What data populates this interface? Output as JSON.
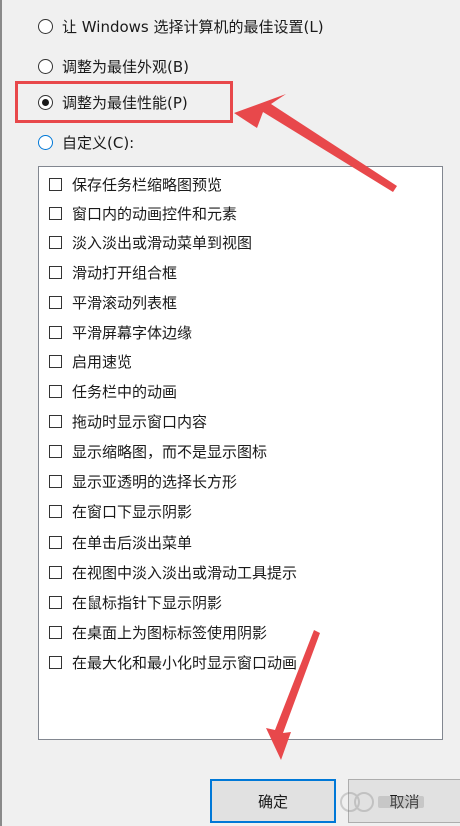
{
  "performance_options": {
    "radios": [
      {
        "label": "让 Windows 选择计算机的最佳设置(L)",
        "checked": false
      },
      {
        "label": "调整为最佳外观(B)",
        "checked": false
      },
      {
        "label": "调整为最佳性能(P)",
        "checked": true
      },
      {
        "label": "自定义(C):",
        "checked": false
      }
    ],
    "visual_effects": [
      {
        "label": "保存任务栏缩略图预览",
        "checked": false
      },
      {
        "label": "窗口内的动画控件和元素",
        "checked": false
      },
      {
        "label": "淡入淡出或滑动菜单到视图",
        "checked": false
      },
      {
        "label": "滑动打开组合框",
        "checked": false
      },
      {
        "label": "平滑滚动列表框",
        "checked": false
      },
      {
        "label": "平滑屏幕字体边缘",
        "checked": false
      },
      {
        "label": "启用速览",
        "checked": false
      },
      {
        "label": "任务栏中的动画",
        "checked": false
      },
      {
        "label": "拖动时显示窗口内容",
        "checked": false
      },
      {
        "label": "显示缩略图，而不是显示图标",
        "checked": false
      },
      {
        "label": "显示亚透明的选择长方形",
        "checked": false
      },
      {
        "label": "在窗口下显示阴影",
        "checked": false
      },
      {
        "label": "在单击后淡出菜单",
        "checked": false
      },
      {
        "label": "在视图中淡入淡出或滑动工具提示",
        "checked": false
      },
      {
        "label": "在鼠标指针下显示阴影",
        "checked": false
      },
      {
        "label": "在桌面上为图标标签使用阴影",
        "checked": false
      },
      {
        "label": "在最大化和最小化时显示窗口动画",
        "checked": false
      }
    ]
  },
  "buttons": {
    "ok_label": "确定",
    "cancel_label": "取消"
  },
  "annotation_color": "#e8484b",
  "focus_color": "#0078d7"
}
